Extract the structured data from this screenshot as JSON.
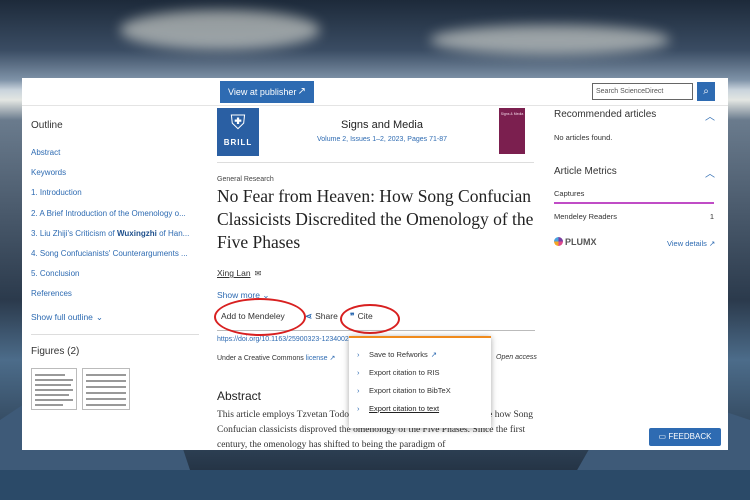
{
  "topbar": {
    "view_publisher": "View at publisher",
    "view_publisher_icon": "external-arrow-icon",
    "search_placeholder": "Search ScienceDirect",
    "search_icon": "search-icon"
  },
  "outline": {
    "title": "Outline",
    "items": [
      {
        "pre": "Abstract",
        "bold": "",
        "post": ""
      },
      {
        "pre": "Keywords",
        "bold": "",
        "post": ""
      },
      {
        "pre": "1. Introduction",
        "bold": "",
        "post": ""
      },
      {
        "pre": "2. A Brief Introduction of the Omenology o...",
        "bold": "",
        "post": ""
      },
      {
        "pre": "3. Liu Zhiji's Criticism of ",
        "bold": "Wuxingzhi",
        "post": " of Han..."
      },
      {
        "pre": "4. Song Confucianists' Counterarguments ...",
        "bold": "",
        "post": ""
      },
      {
        "pre": "5. Conclusion",
        "bold": "",
        "post": ""
      },
      {
        "pre": "References",
        "bold": "",
        "post": ""
      }
    ],
    "show_full": "Show full outline"
  },
  "figures": {
    "title": "Figures (2)"
  },
  "journal": {
    "publisher_logo_text": "BRILL",
    "title": "Signs and Media",
    "info": "Volume 2, Issues 1–2, 2023, Pages 71-87",
    "cover_text": "Signs & Media"
  },
  "article": {
    "category": "General Research",
    "title": "No Fear from Heaven: How Song Confucian Classicists Discredited the Omenology of the Five Phases",
    "author": "Xing Lan",
    "show_more": "Show more",
    "actions": {
      "mendeley": "Add to Mendeley",
      "share": "Share",
      "cite": "Cite"
    },
    "doi": "https://doi.org/10.1163/25900323-12340021",
    "license_prefix": "Under a Creative Commons ",
    "license_link": "license",
    "open_access": "Open access",
    "abstract_heading": "Abstract",
    "abstract_text": "This article employs Tzvetan Todorov's theory of symbolism to examine how Song Confucian classicists disproved the omenology of the Five Phases. Since the first century, the omenology has shifted to being the paradigm of"
  },
  "cite_menu": {
    "items": [
      {
        "label": "Save to Refworks",
        "external": true
      },
      {
        "label": "Export citation to RIS",
        "external": false
      },
      {
        "label": "Export citation to BibTeX",
        "external": false
      },
      {
        "label": "Export citation to text",
        "external": false
      }
    ]
  },
  "right": {
    "recommended_title": "Recommended articles",
    "no_articles": "No articles found.",
    "metrics_title": "Article Metrics",
    "captures": "Captures",
    "mendeley_readers_label": "Mendeley Readers",
    "mendeley_readers_value": "1",
    "plumx": "PLUMX",
    "view_details": "View details"
  },
  "feedback": "FEEDBACK",
  "colors": {
    "link_blue": "#2e6bb2",
    "annotation_red": "#d82020",
    "menu_accent": "#f08a1c"
  }
}
